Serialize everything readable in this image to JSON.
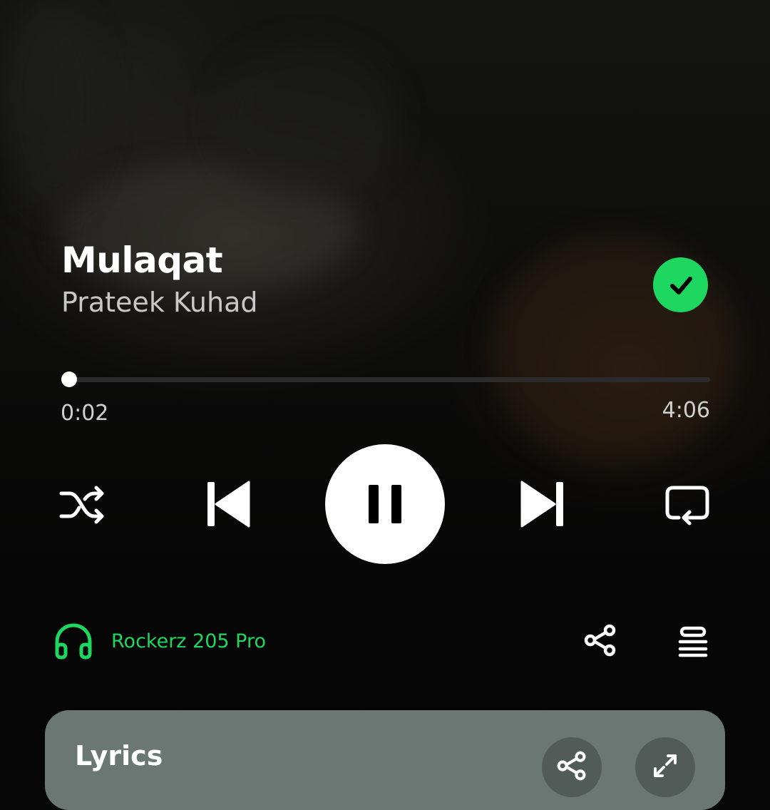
{
  "track": {
    "title": "Mulaqat",
    "artist": "Prateek Kuhad",
    "liked": true
  },
  "playback": {
    "elapsed": "0:02",
    "duration": "4:06",
    "progress_fraction": 0.008,
    "state": "playing"
  },
  "controls": {
    "shuffle_icon": "shuffle-icon",
    "previous_icon": "skip-previous-icon",
    "pause_icon": "pause-icon",
    "next_icon": "skip-next-icon",
    "repeat_icon": "repeat-icon"
  },
  "device": {
    "name": "Rockerz 205 Pro",
    "icon": "headphones-icon"
  },
  "actions": {
    "share_icon": "share-icon",
    "queue_icon": "queue-icon"
  },
  "lyrics": {
    "title": "Lyrics",
    "share_icon": "share-icon",
    "expand_icon": "expand-icon"
  },
  "colors": {
    "accent": "#1ed760",
    "lyrics_card": "#6b7773",
    "background": "#070707"
  }
}
